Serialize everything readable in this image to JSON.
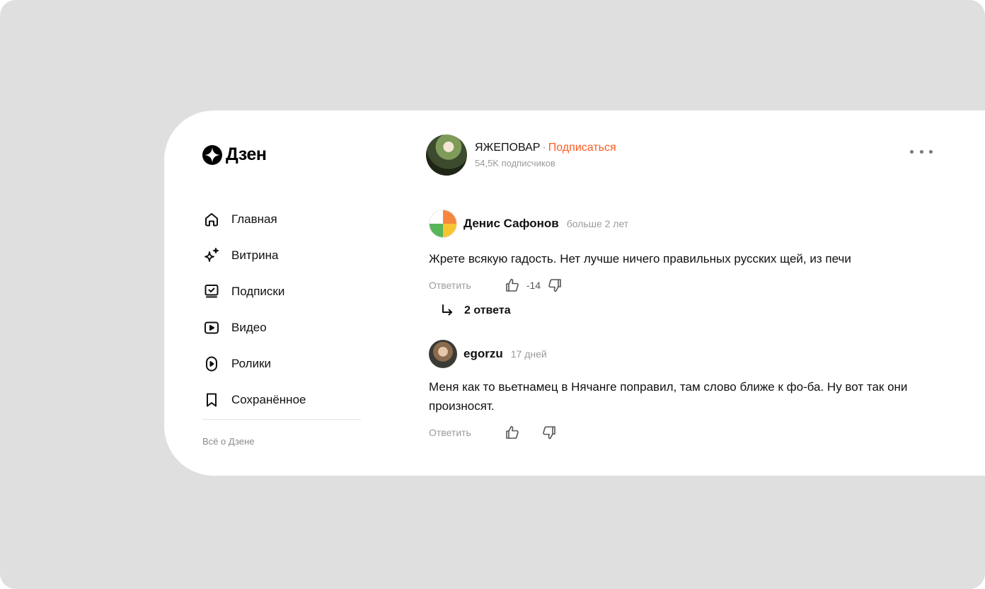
{
  "brand": {
    "name": "Дзен",
    "icon": "zen-logo-icon"
  },
  "sidebar": {
    "items": [
      {
        "label": "Главная",
        "icon": "home-icon"
      },
      {
        "label": "Витрина",
        "icon": "sparkle-icon"
      },
      {
        "label": "Подписки",
        "icon": "subscriptions-icon"
      },
      {
        "label": "Видео",
        "icon": "video-icon"
      },
      {
        "label": "Ролики",
        "icon": "shorts-icon"
      },
      {
        "label": "Сохранённое",
        "icon": "bookmark-icon"
      }
    ],
    "footer_link": "Всё о Дзене"
  },
  "channel": {
    "name": "ЯЖЕПОВАР",
    "separator": "·",
    "subscribe_label": "Подписаться",
    "subscribers": "54,5K подписчиков",
    "subscribe_color": "#ff5a1f"
  },
  "comments": [
    {
      "author": "Денис Сафонов",
      "time": "больше 2 лет",
      "text": "Жрете всякую гадость. Нет лучше ничего правильных русских щей, из печи",
      "reply_label": "Ответить",
      "score": "-14",
      "answers_label": "2 ответа"
    },
    {
      "author": "egorzu",
      "time": "17 дней",
      "text": "Меня как то вьетнамец в Нячанге поправил, там слово ближе к фо-ба. Ну вот так они произносят.",
      "reply_label": "Ответить"
    }
  ]
}
